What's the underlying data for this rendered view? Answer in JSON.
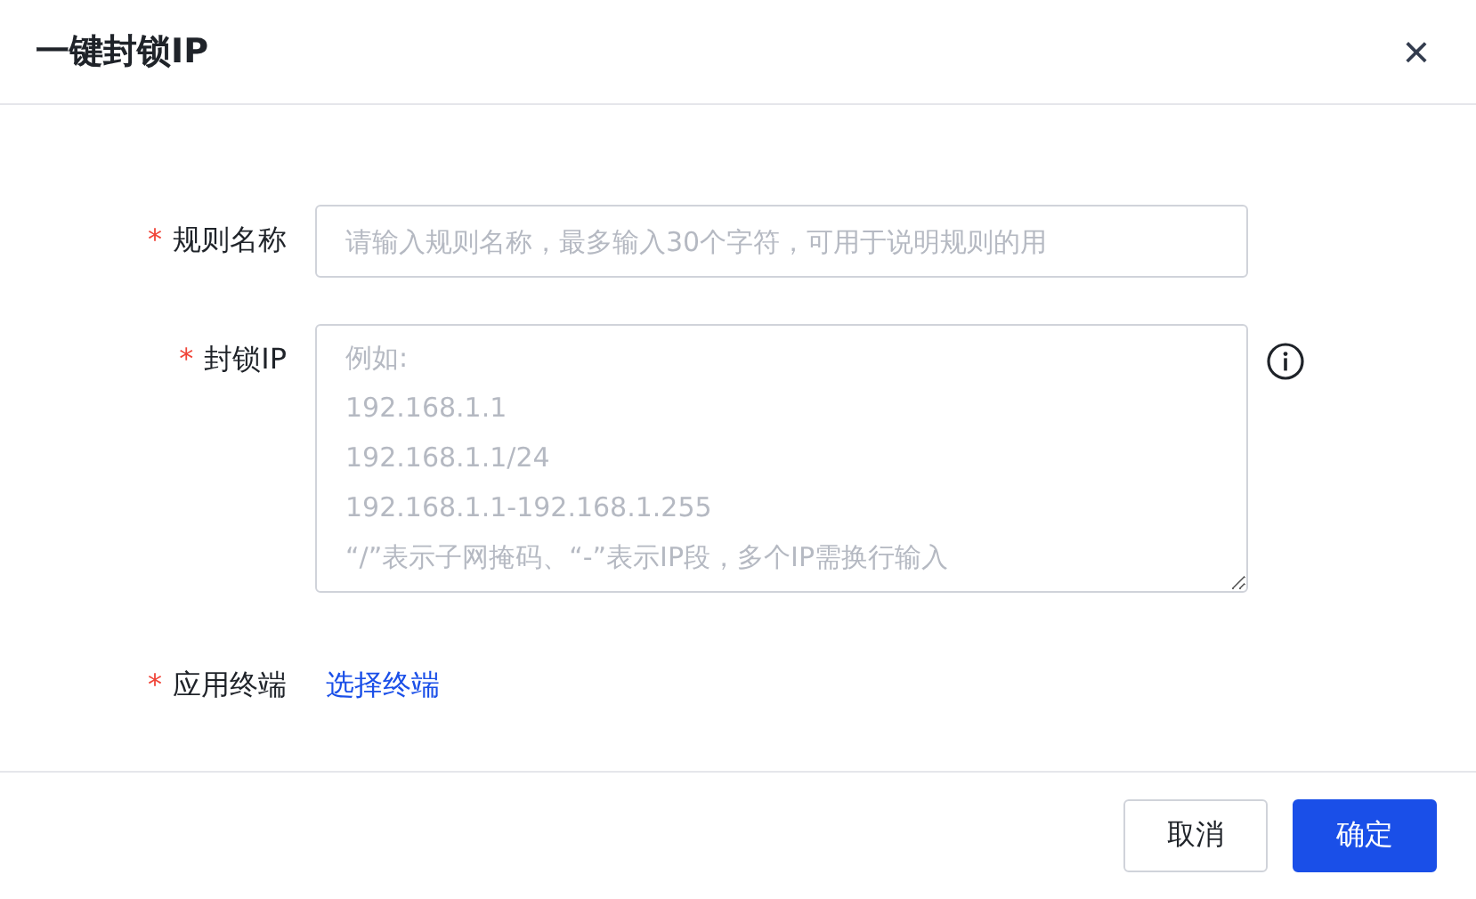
{
  "dialog": {
    "title": "一键封锁IP",
    "close": "×"
  },
  "form": {
    "fields": [
      {
        "kind": "input",
        "label": "规则名称",
        "required_mark": "*",
        "placeholder": "请输入规则名称，最多输入30个字符，可用于说明规则的用"
      },
      {
        "kind": "textarea",
        "label": "封锁IP",
        "required_mark": "*",
        "placeholder": "例如:\n192.168.1.1\n192.168.1.1/24\n192.168.1.1-192.168.1.255\n“/”表示子网掩码、“-”表示IP段，多个IP需换行输入",
        "info": true
      },
      {
        "kind": "link",
        "label": "应用终端",
        "required_mark": "*",
        "value": "选择终端"
      }
    ]
  },
  "buttons": [
    {
      "label": "取消",
      "kind": "secondary"
    },
    {
      "label": "确定",
      "kind": "primary"
    }
  ]
}
